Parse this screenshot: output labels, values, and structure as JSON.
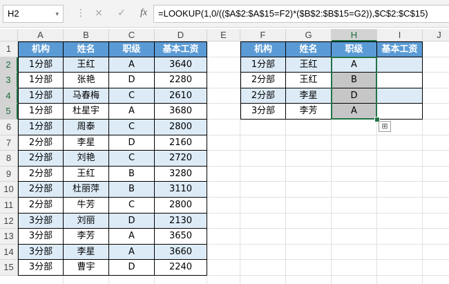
{
  "name_box": "H2",
  "formula": "=LOOKUP(1,0/(($A$2:$A$15=F2)*($B$2:$B$15=G2)),$C$2:$C$15)",
  "icons": {
    "cancel": "×",
    "enter": "✓",
    "fx": "fx",
    "dots": "⋮",
    "dropdown": "▾"
  },
  "columns": [
    "A",
    "B",
    "C",
    "D",
    "E",
    "F",
    "G",
    "H",
    "I",
    "J"
  ],
  "rows": [
    "1",
    "2",
    "3",
    "4",
    "5",
    "6",
    "7",
    "8",
    "9",
    "10",
    "11",
    "12",
    "13",
    "14",
    "15"
  ],
  "colors": {
    "header_fill": "#5b9bd5",
    "band_fill": "#ddebf7",
    "selection": "#217346",
    "result_fill": "#c6c6c6"
  },
  "table1": {
    "headers": [
      "机构",
      "姓名",
      "职级",
      "基本工资"
    ],
    "rows": [
      [
        "1分部",
        "王红",
        "A",
        "3640"
      ],
      [
        "1分部",
        "张艳",
        "D",
        "2280"
      ],
      [
        "1分部",
        "马春梅",
        "C",
        "2610"
      ],
      [
        "1分部",
        "杜星宇",
        "A",
        "3680"
      ],
      [
        "1分部",
        "周泰",
        "C",
        "2800"
      ],
      [
        "2分部",
        "李星",
        "D",
        "2160"
      ],
      [
        "2分部",
        "刘艳",
        "C",
        "2720"
      ],
      [
        "2分部",
        "王红",
        "B",
        "3280"
      ],
      [
        "2分部",
        "杜丽萍",
        "B",
        "3110"
      ],
      [
        "2分部",
        "牛芳",
        "C",
        "2800"
      ],
      [
        "3分部",
        "刘丽",
        "D",
        "2130"
      ],
      [
        "3分部",
        "李芳",
        "A",
        "3650"
      ],
      [
        "3分部",
        "李星",
        "A",
        "3660"
      ],
      [
        "3分部",
        "曹宇",
        "D",
        "2240"
      ]
    ]
  },
  "table2": {
    "headers": [
      "机构",
      "姓名",
      "职级",
      "基本工资"
    ],
    "rows": [
      [
        "1分部",
        "王红",
        "A",
        ""
      ],
      [
        "2分部",
        "王红",
        "B",
        ""
      ],
      [
        "2分部",
        "李星",
        "D",
        ""
      ],
      [
        "3分部",
        "李芳",
        "A",
        ""
      ]
    ]
  }
}
